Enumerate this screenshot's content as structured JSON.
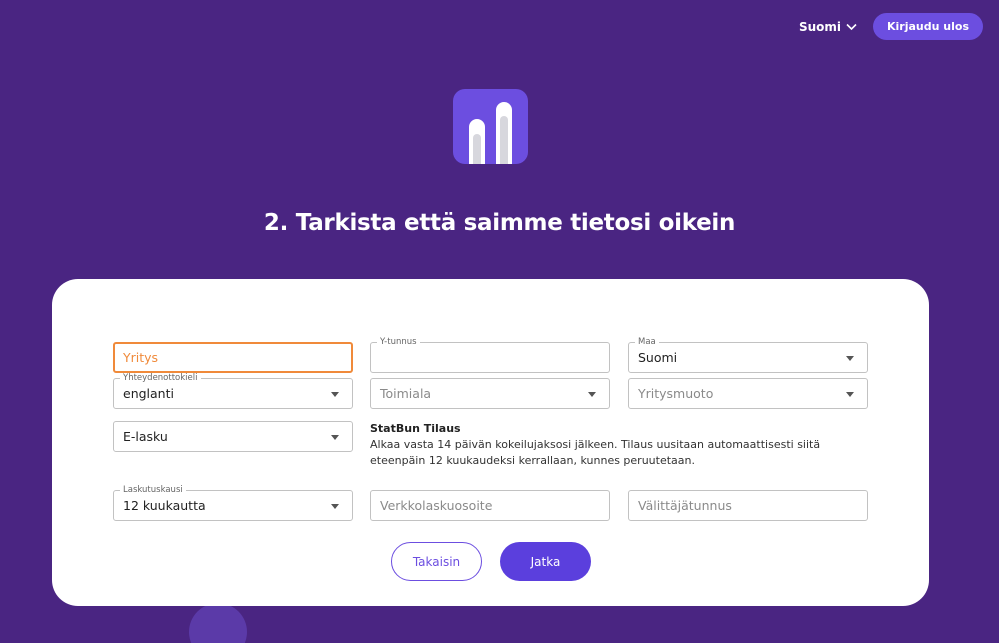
{
  "header": {
    "language": "Suomi",
    "logout_label": "Kirjaudu ulos"
  },
  "colors": {
    "background": "#4a2582",
    "accent": "#6c4ee0",
    "focus": "#f08a3a"
  },
  "page_title": "2. Tarkista että saimme tietosi oikein",
  "form": {
    "company": {
      "placeholder": "Yritys"
    },
    "business_id": {
      "label": "Y-tunnus",
      "value": ""
    },
    "country": {
      "label": "Maa",
      "value": "Suomi"
    },
    "contact_language": {
      "label": "Yhteydenottokieli",
      "value": "englanti"
    },
    "industry": {
      "placeholder": "Toimiala"
    },
    "company_form": {
      "placeholder": "Yritysmuoto"
    },
    "invoice_type": {
      "value": "E-lasku"
    },
    "billing_period": {
      "label": "Laskutuskausi",
      "value": "12 kuukautta"
    },
    "e_invoice_address": {
      "placeholder": "Verkkolaskuosoite"
    },
    "operator_id": {
      "placeholder": "Välittäjätunnus"
    }
  },
  "subscription": {
    "title": "StatBun Tilaus",
    "description": "Alkaa vasta 14 päivän kokeilujaksosi jälkeen. Tilaus uusitaan automaattisesti siitä eteenpäin 12 kuukaudeksi kerrallaan, kunnes peruutetaan."
  },
  "buttons": {
    "back": "Takaisin",
    "continue": "Jatka"
  }
}
